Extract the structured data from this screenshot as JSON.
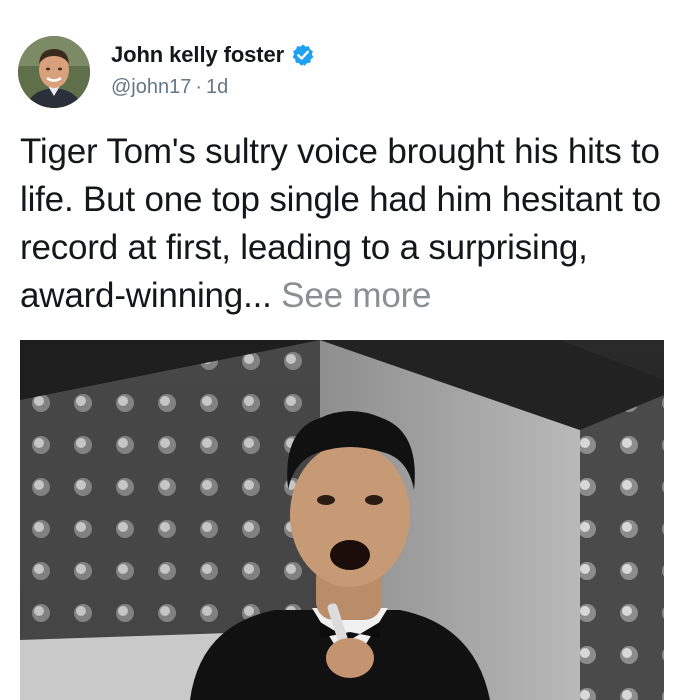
{
  "author": {
    "display_name": "John kelly foster",
    "handle": "@john17",
    "separator": "·",
    "age": "1d",
    "verified_icon": "verified-badge-icon",
    "verified_color": "#1da1f2"
  },
  "tweet": {
    "text": "Tiger Tom's sultry voice brought his hits to life. But one top single had him hesitant to record at first, leading to a surprising, award-winning... ",
    "see_more": "See more"
  },
  "colors": {
    "text": "#14171a",
    "muted": "#657786",
    "see_more": "#8a8f94"
  }
}
